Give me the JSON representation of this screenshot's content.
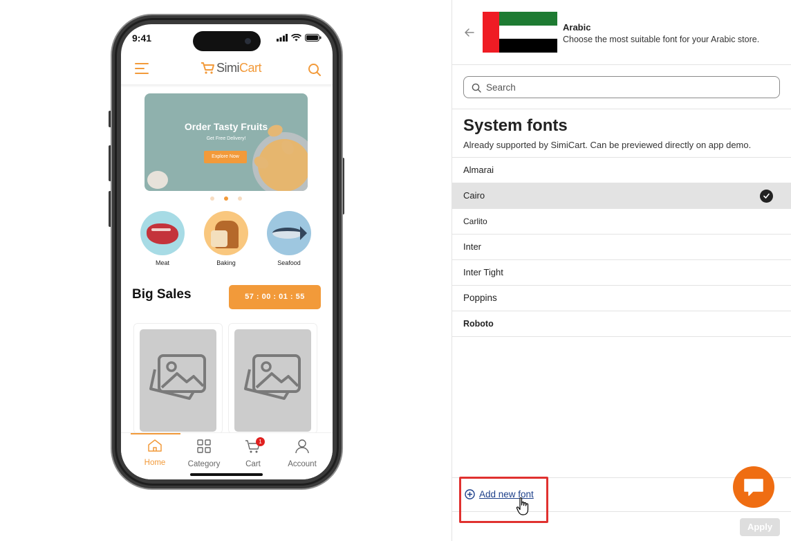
{
  "phone": {
    "status_time": "9:41",
    "logo_prefix": "Simi",
    "logo_suffix": "Cart",
    "banner": {
      "title": "Order Tasty Fruits",
      "subtitle": "Get Free Delivery!",
      "button": "Explore Now",
      "active_dot": 1
    },
    "categories": [
      {
        "label": "Meat"
      },
      {
        "label": "Baking"
      },
      {
        "label": "Seafood"
      }
    ],
    "big_sales_title": "Big Sales",
    "timer": "57 : 00 : 01 : 55",
    "tabs": [
      {
        "label": "Home",
        "icon": "home-icon",
        "active": true
      },
      {
        "label": "Category",
        "icon": "grid-icon",
        "active": false
      },
      {
        "label": "Cart",
        "icon": "cart-icon",
        "active": false,
        "badge": "1"
      },
      {
        "label": "Account",
        "icon": "user-icon",
        "active": false
      }
    ]
  },
  "panel": {
    "language": "Arabic",
    "language_description": "Choose the most suitable font for your Arabic store.",
    "search_placeholder": "Search",
    "section_title": "System fonts",
    "section_description": "Already supported by SimiCart. Can be previewed directly on app demo.",
    "fonts": [
      {
        "name": "Almarai",
        "selected": false
      },
      {
        "name": "Cairo",
        "selected": true
      },
      {
        "name": "Carlito",
        "selected": false
      },
      {
        "name": "Inter",
        "selected": false
      },
      {
        "name": "Inter Tight",
        "selected": false
      },
      {
        "name": "Poppins",
        "selected": false
      },
      {
        "name": "Roboto",
        "selected": false
      }
    ],
    "add_font_label": "Add new font",
    "apply_label": "Apply"
  },
  "colors": {
    "accent_orange": "#f29a3a",
    "chat_orange": "#ef6d12",
    "highlight_red": "#e0312f",
    "link_blue": "#1c3f8a",
    "badge_red": "#e0201f"
  }
}
